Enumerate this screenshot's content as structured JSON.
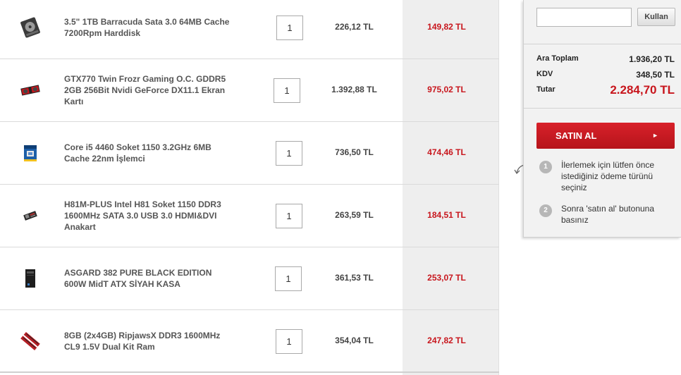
{
  "cart": {
    "items": [
      {
        "name": "3.5\" 1TB Barracuda Sata 3.0 64MB Cache 7200Rpm Harddisk",
        "qty": "1",
        "unit_price": "226,12 TL",
        "total": "149,82 TL",
        "icon": "harddisk-icon"
      },
      {
        "name": "GTX770 Twin Frozr Gaming O.C. GDDR5 2GB 256Bit Nvidi GeForce DX11.1 Ekran Kartı",
        "qty": "1",
        "unit_price": "1.392,88 TL",
        "total": "975,02 TL",
        "icon": "graphics-card-icon"
      },
      {
        "name": "Core i5 4460 Soket 1150 3.2GHz 6MB Cache 22nm İşlemci",
        "qty": "1",
        "unit_price": "736,50 TL",
        "total": "474,46 TL",
        "icon": "processor-box-icon"
      },
      {
        "name": "H81M-PLUS Intel H81 Soket 1150 DDR3 1600MHz SATA 3.0 USB 3.0 HDMI&DVI Anakart",
        "qty": "1",
        "unit_price": "263,59 TL",
        "total": "184,51 TL",
        "icon": "motherboard-icon"
      },
      {
        "name": "ASGARD 382 PURE BLACK EDITION 600W MidT ATX SİYAH KASA",
        "qty": "1",
        "unit_price": "361,53 TL",
        "total": "253,07 TL",
        "icon": "pc-case-icon"
      },
      {
        "name": "8GB (2x4GB) RipjawsX DDR3 1600MHz CL9 1.5V Dual Kit Ram",
        "qty": "1",
        "unit_price": "354,04 TL",
        "total": "247,82 TL",
        "icon": "ram-icon"
      }
    ]
  },
  "summary": {
    "coupon_value": "",
    "coupon_button": "Kullan",
    "subtotal_label": "Ara Toplam",
    "subtotal_value": "1.936,20 TL",
    "tax_label": "KDV",
    "tax_value": "348,50 TL",
    "grand_label": "Tutar",
    "grand_value": "2.284,70 TL",
    "buy_label": "SATIN AL",
    "buy_arrow": "►",
    "steps": [
      {
        "num": "1",
        "text": "İlerlemek için lütfen önce istediğiniz ödeme türünü seçiniz"
      },
      {
        "num": "2",
        "text": "Sonra 'satın al' butonuna basınız"
      }
    ]
  },
  "colors": {
    "accent": "#c8161d",
    "column_shade": "#eeeeee",
    "panel": "#f2f2f2"
  }
}
